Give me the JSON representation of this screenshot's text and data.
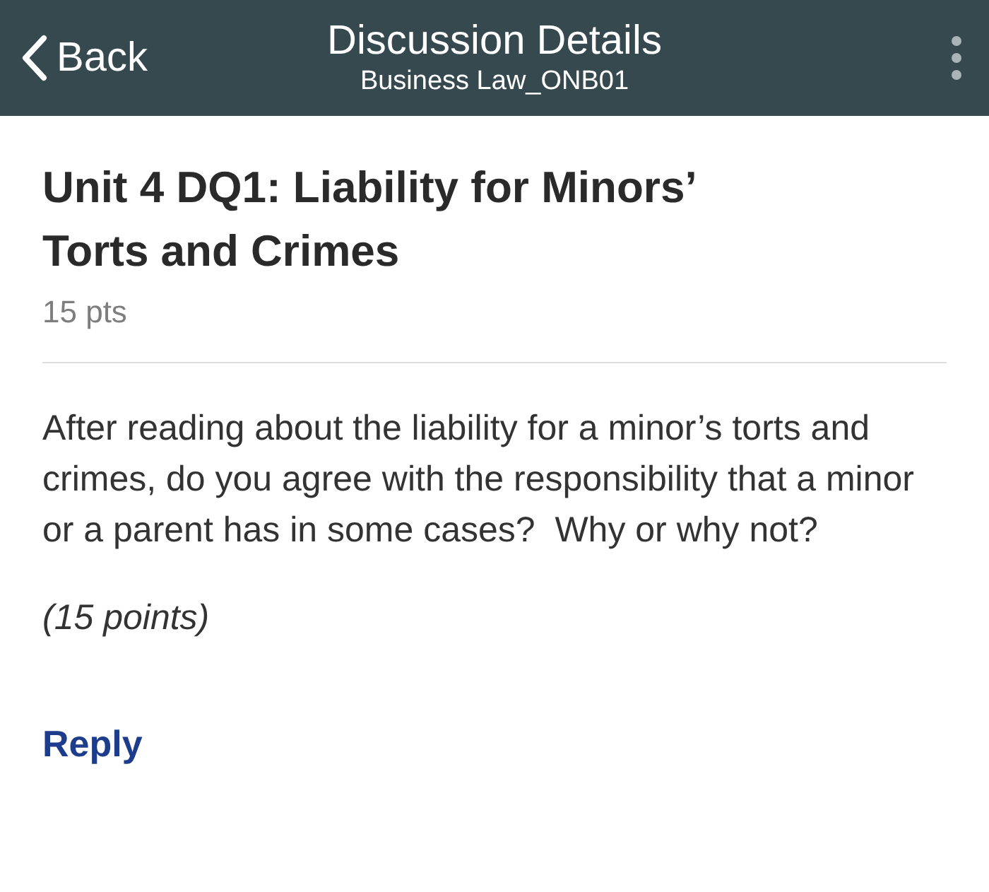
{
  "nav_bar": {
    "back_label": "Back",
    "title": "Discussion Details",
    "subtitle": "Business Law_ONB01"
  },
  "discussion": {
    "title": "Unit 4 DQ1: Liability for Minors’ Torts and Crimes",
    "points": "15 pts",
    "body": [
      {
        "kind": "plain",
        "text": "After reading about the liability for a minor’s torts and crimes, do you agree with the responsibility that a minor or a parent has in some cases?  Why or why not?"
      },
      {
        "kind": "italic",
        "text": "(15 points)"
      }
    ],
    "reply_label": "Reply"
  }
}
